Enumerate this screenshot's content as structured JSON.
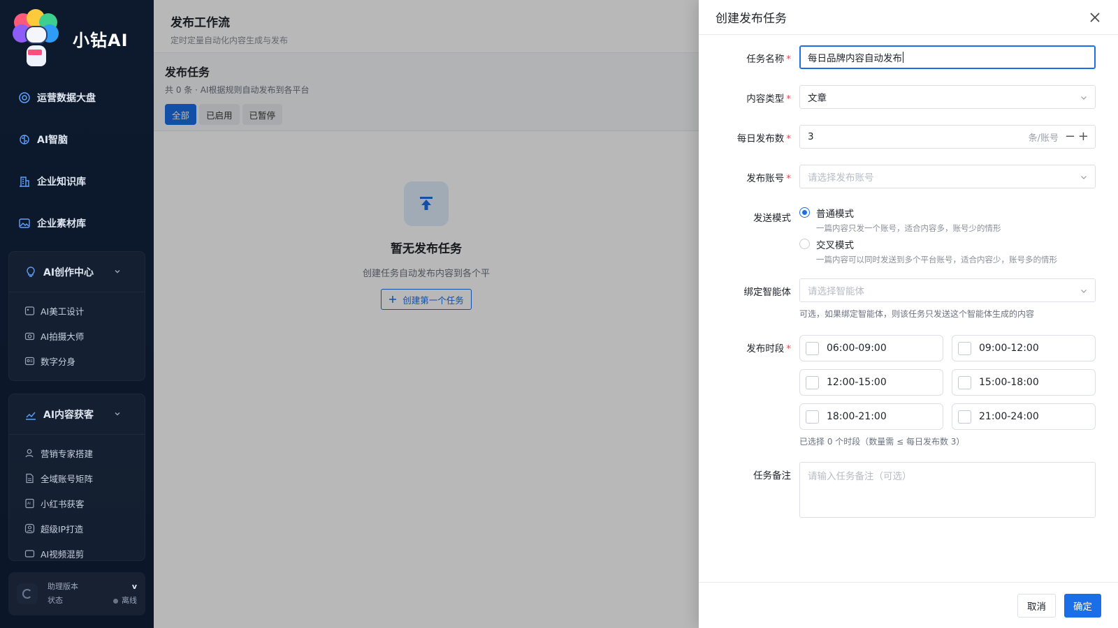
{
  "brand": {
    "name": "小钻AI",
    "mascot_tag": "小钻"
  },
  "nav": [
    {
      "label": "运营数据大盘",
      "icon": "dashboard-icon"
    },
    {
      "label": "AI智脑",
      "icon": "brain-icon"
    },
    {
      "label": "企业知识库",
      "icon": "building-icon"
    },
    {
      "label": "企业素材库",
      "icon": "image-icon"
    }
  ],
  "groups": [
    {
      "title": "AI创作中心",
      "icon": "bulb-icon",
      "items": [
        {
          "label": "AI美工设计",
          "icon": "design-icon"
        },
        {
          "label": "AI拍摄大师",
          "icon": "camera-icon"
        },
        {
          "label": "数字分身",
          "icon": "avatar-card-icon"
        }
      ]
    },
    {
      "title": "AI内容获客",
      "icon": "trend-icon",
      "items": [
        {
          "label": "营销专家搭建",
          "icon": "user-icon"
        },
        {
          "label": "全域账号矩阵",
          "icon": "document-icon"
        },
        {
          "label": "小红书获客",
          "icon": "ai-doc-icon"
        },
        {
          "label": "超级IP打造",
          "icon": "ip-icon"
        },
        {
          "label": "AI视频混剪",
          "icon": "video-icon"
        }
      ]
    }
  ],
  "status_card": {
    "version_label": "助理版本",
    "version_value": "v",
    "state_label": "状态",
    "state_value": "离线"
  },
  "main": {
    "title": "发布工作流",
    "subtitle": "定时定量自动化内容生成与发布",
    "section_title": "发布任务",
    "section_desc": "共 0 条 · AI根据规则自动发布到各平台",
    "filters": [
      "全部",
      "已启用",
      "已暂停"
    ],
    "empty_title": "暂无发布任务",
    "empty_desc": "创建任务自动发布内容到各个平",
    "create_first": "创建第一个任务"
  },
  "drawer": {
    "title": "创建发布任务",
    "fields": {
      "task_name": {
        "label": "任务名称",
        "value": "每日品牌内容自动发布"
      },
      "content_type": {
        "label": "内容类型",
        "value": "文章"
      },
      "daily_count": {
        "label": "每日发布数",
        "value": "3",
        "unit": "条/账号",
        "minus": "−",
        "plus": "+"
      },
      "account": {
        "label": "发布账号",
        "placeholder": "请选择发布账号"
      },
      "send_mode": {
        "label": "发送模式",
        "options": [
          {
            "title": "普通模式",
            "desc": "一篇内容只发一个账号，适合内容多，账号少的情形",
            "selected": true
          },
          {
            "title": "交叉模式",
            "desc": "一篇内容可以同时发送到多个平台账号，适合内容少，账号多的情形",
            "selected": false
          }
        ]
      },
      "agent": {
        "label": "绑定智能体",
        "placeholder": "请选择智能体",
        "hint": "可选，如果绑定智能体，则该任务只发送这个智能体生成的内容"
      },
      "time_slots": {
        "label": "发布时段",
        "slots": [
          "06:00-09:00",
          "09:00-12:00",
          "12:00-15:00",
          "15:00-18:00",
          "18:00-21:00",
          "21:00-24:00"
        ],
        "summary": "已选择 0 个时段（数量需 ≤ 每日发布数 3）"
      },
      "note": {
        "label": "任务备注",
        "placeholder": "请输入任务备注（可选）"
      }
    },
    "cancel": "取消",
    "confirm": "确定"
  },
  "colors": {
    "accent": "#1a6ee8",
    "required": "#e34d59",
    "sidebar_bg": "#0d1a2e"
  }
}
